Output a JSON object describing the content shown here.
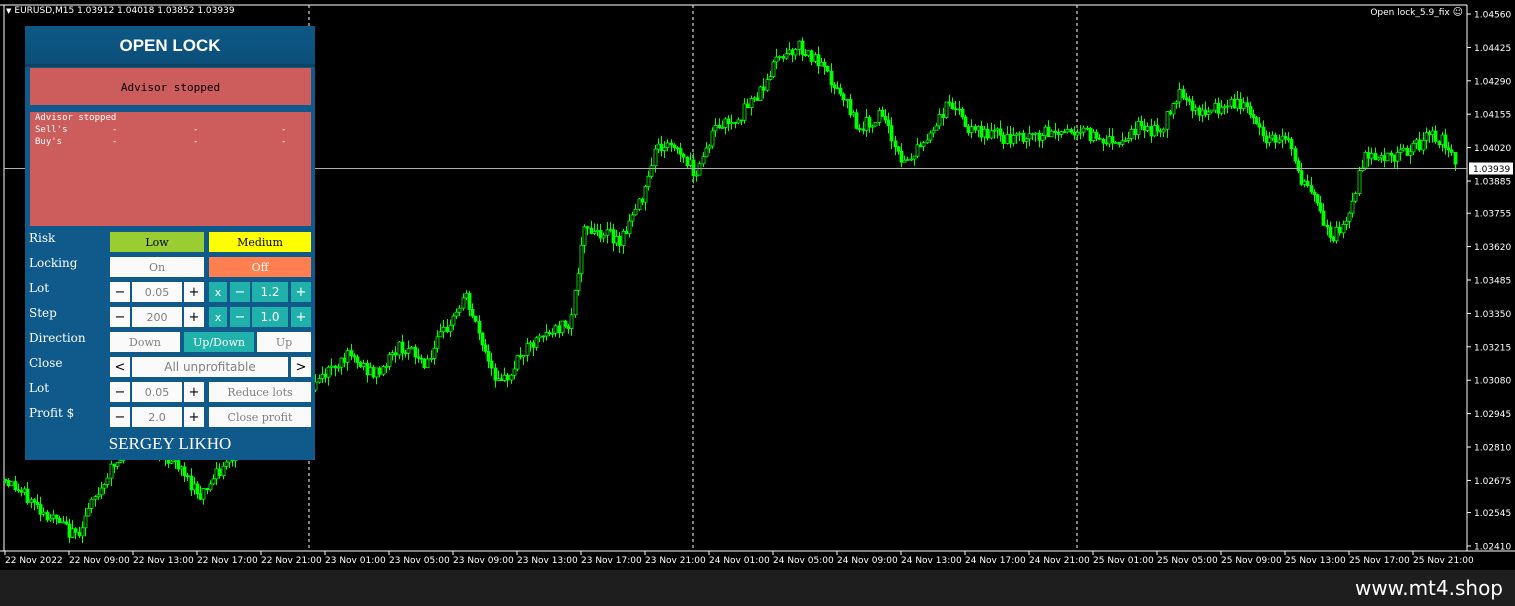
{
  "chart": {
    "symbol_info": "EURUSD,M15  1.03912 1.04018 1.03852 1.03939",
    "ea_name": "Open lock_5.9_fix",
    "price_levels": [
      "1.04560",
      "1.04425",
      "1.04290",
      "1.04155",
      "1.04020",
      "1.03885",
      "1.03755",
      "1.03620",
      "1.03485",
      "1.03350",
      "1.03215",
      "1.03080",
      "1.02945",
      "1.02810",
      "1.02675",
      "1.02545",
      "1.02410"
    ],
    "current_price": "1.03939",
    "time_labels": [
      "22 Nov 2022",
      "22 Nov 09:00",
      "22 Nov 13:00",
      "22 Nov 17:00",
      "22 Nov 21:00",
      "23 Nov 01:00",
      "23 Nov 05:00",
      "23 Nov 09:00",
      "23 Nov 13:00",
      "23 Nov 17:00",
      "23 Nov 21:00",
      "24 Nov 01:00",
      "24 Nov 05:00",
      "24 Nov 09:00",
      "24 Nov 13:00",
      "24 Nov 17:00",
      "24 Nov 21:00",
      "25 Nov 01:00",
      "25 Nov 05:00",
      "25 Nov 09:00",
      "25 Nov 13:00",
      "25 Nov 17:00",
      "25 Nov 21:00"
    ],
    "colors": {
      "background": "#000000",
      "candle": "#00ff00",
      "axis": "#ffffff"
    }
  },
  "panel": {
    "title": "OPEN LOCK",
    "status": "Advisor stopped",
    "info": {
      "line1": "Advisor stopped",
      "sells_label": "Sell's",
      "buys_label": "Buy's",
      "dash": "-"
    },
    "risk": {
      "label": "Risk",
      "low": "Low",
      "medium": "Medium"
    },
    "locking": {
      "label": "Locking",
      "on": "On",
      "off": "Off"
    },
    "lot": {
      "label": "Lot",
      "minus": "−",
      "value": "0.05",
      "plus": "+",
      "x": "x",
      "mult": "1.2"
    },
    "step": {
      "label": "Step",
      "minus": "−",
      "value": "200",
      "plus": "+",
      "x": "x",
      "mult": "1.0"
    },
    "direction": {
      "label": "Direction",
      "down": "Down",
      "updown": "Up/Down",
      "up": "Up"
    },
    "close": {
      "label": "Close",
      "left": "<",
      "value": "All unprofitable",
      "right": ">"
    },
    "lot2": {
      "label": "Lot",
      "minus": "−",
      "value": "0.05",
      "plus": "+",
      "action": "Reduce lots"
    },
    "profit": {
      "label": "Profit $",
      "minus": "−",
      "value": "2.0",
      "plus": "+",
      "action": "Close profit"
    },
    "author": "SERGEY LIKHO",
    "colors": {
      "panel": "#0f5a8a",
      "status": "#cd5c5c",
      "low": "#9acd32",
      "medium": "#ffff00",
      "off": "#ff7f50",
      "teal": "#20b2aa"
    }
  },
  "footer": {
    "site": "www.mt4.shop"
  }
}
